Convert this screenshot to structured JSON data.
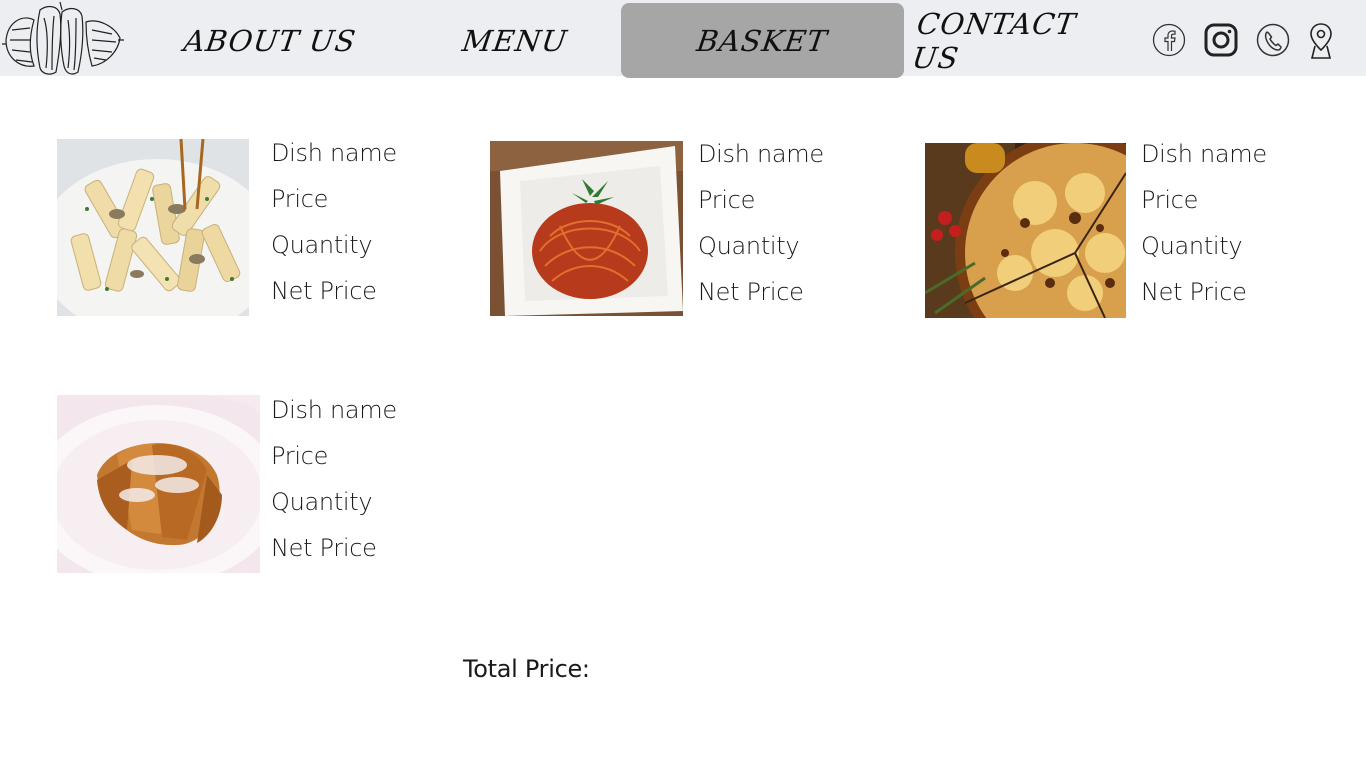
{
  "nav": {
    "items": [
      {
        "label": "ABOUT US",
        "active": false
      },
      {
        "label": "MENU",
        "active": false
      },
      {
        "label": "BASKET",
        "active": true
      },
      {
        "label": "CONTACT US",
        "active": false
      }
    ],
    "active_color": "#a6a6a6",
    "bar_color": "#eceef1"
  },
  "social_icons": [
    "facebook-icon",
    "instagram-icon",
    "phone-icon",
    "location-pin-icon"
  ],
  "basket": {
    "items": [
      {
        "image": "penne-pasta",
        "dish_name": "Dish name",
        "price": "Price",
        "quantity": "Quantity",
        "net_price": "Net Price"
      },
      {
        "image": "spaghetti",
        "dish_name": "Dish name",
        "price": "Price",
        "quantity": "Quantity",
        "net_price": "Net Price"
      },
      {
        "image": "pizza",
        "dish_name": "Dish name",
        "price": "Price",
        "quantity": "Quantity",
        "net_price": "Net Price"
      },
      {
        "image": "croissant",
        "dish_name": "Dish name",
        "price": "Price",
        "quantity": "Quantity",
        "net_price": "Net Price"
      }
    ],
    "total_label": "Total Price:"
  }
}
